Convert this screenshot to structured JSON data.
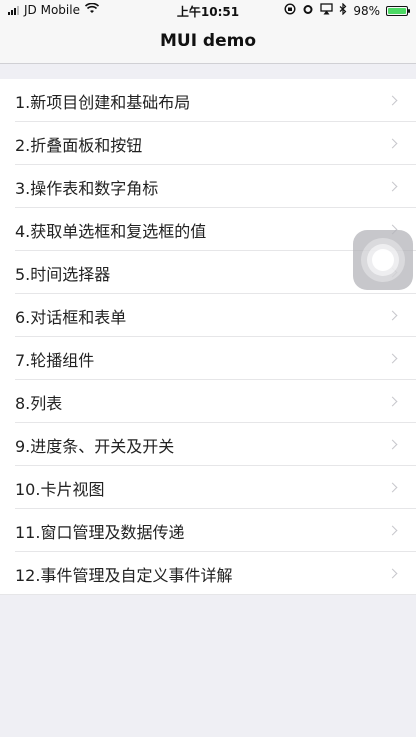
{
  "status_bar": {
    "carrier": "JD Mobile",
    "time": "上午10:51",
    "battery_percent": "98%",
    "battery_level": 0.98
  },
  "nav": {
    "title": "MUI demo"
  },
  "menu": {
    "items": [
      {
        "label": "1.新项目创建和基础布局"
      },
      {
        "label": "2.折叠面板和按钮"
      },
      {
        "label": "3.操作表和数字角标"
      },
      {
        "label": "4.获取单选框和复选框的值"
      },
      {
        "label": "5.时间选择器"
      },
      {
        "label": "6.对话框和表单"
      },
      {
        "label": "7.轮播组件"
      },
      {
        "label": "8.列表"
      },
      {
        "label": "9.进度条、开关及开关"
      },
      {
        "label": "10.卡片视图"
      },
      {
        "label": "11.窗口管理及数据传递"
      },
      {
        "label": "12.事件管理及自定义事件详解"
      }
    ]
  },
  "colors": {
    "battery_fill": "#4cd964",
    "background": "#efeff4",
    "chevron": "#c7c7cc"
  }
}
